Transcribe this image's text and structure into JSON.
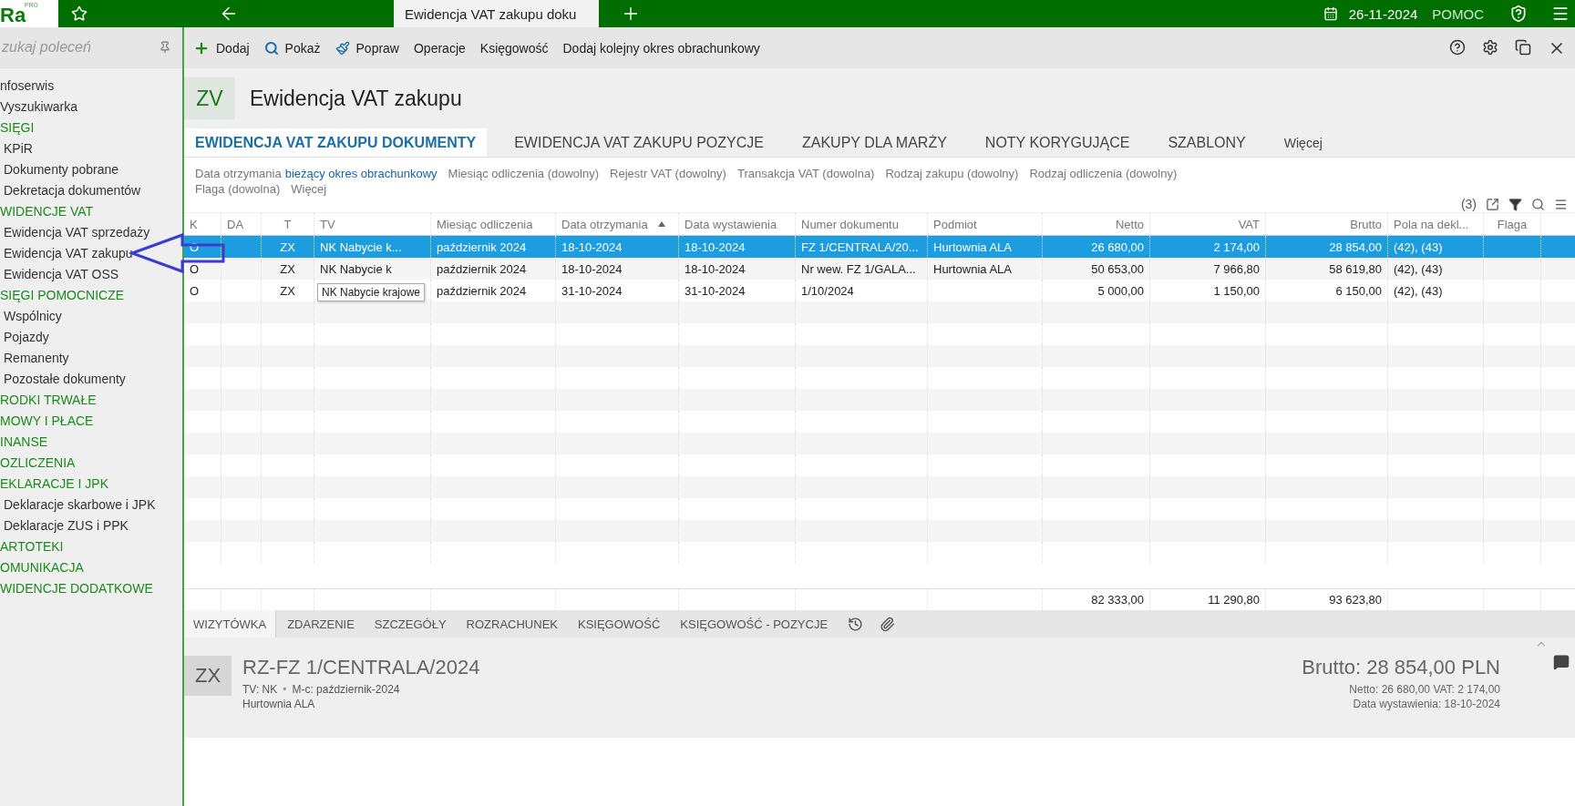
{
  "topbar": {
    "logo": "Ra",
    "logo_sup": "PRO",
    "tab": "Ewidencja VAT zakupu doku",
    "date": "26-11-2024",
    "help": "POMOC"
  },
  "sidebar": {
    "search": {
      "placeholder": "zukaj poleceń"
    },
    "items": [
      {
        "label": "nfoserwis",
        "kind": "link"
      },
      {
        "label": "Vyszukiwarka",
        "kind": "link"
      },
      {
        "label": "SIĘGI",
        "kind": "group",
        "children": [
          {
            "label": "KPiR"
          },
          {
            "label": "Dokumenty pobrane"
          },
          {
            "label": "Dekretacja dokumentów"
          }
        ]
      },
      {
        "label": "WIDENCJE VAT",
        "kind": "group",
        "children": [
          {
            "label": "Ewidencja VAT sprzedaży"
          },
          {
            "label": "Ewidencja VAT zakupu"
          },
          {
            "label": "Ewidencja VAT OSS"
          }
        ]
      },
      {
        "label": "SIĘGI POMOCNICZE",
        "kind": "group",
        "children": [
          {
            "label": "Wspólnicy"
          },
          {
            "label": "Pojazdy"
          },
          {
            "label": "Remanenty"
          },
          {
            "label": "Pozostałe dokumenty"
          }
        ]
      },
      {
        "label": "RODKI TRWAŁE",
        "kind": "group"
      },
      {
        "label": "MOWY I PŁACE",
        "kind": "group"
      },
      {
        "label": "INANSE",
        "kind": "group"
      },
      {
        "label": "OZLICZENIA",
        "kind": "group"
      },
      {
        "label": "EKLARACJE I JPK",
        "kind": "group",
        "children": [
          {
            "label": "Deklaracje skarbowe i JPK"
          },
          {
            "label": "Deklaracje ZUS i PPK"
          }
        ]
      },
      {
        "label": "ARTOTEKI",
        "kind": "group"
      },
      {
        "label": "OMUNIKACJA",
        "kind": "group"
      },
      {
        "label": "WIDENCJE DODATKOWE",
        "kind": "group"
      }
    ]
  },
  "toolbar": [
    {
      "label": "Dodaj",
      "kind": "add"
    },
    {
      "label": "Pokaż",
      "kind": "show"
    },
    {
      "label": "Popraw",
      "kind": "edit"
    },
    {
      "label": "Operacje",
      "kind": "plain"
    },
    {
      "label": "Księgowość",
      "kind": "plain"
    },
    {
      "label": "Dodaj kolejny okres obrachunkowy",
      "kind": "plain"
    }
  ],
  "header": {
    "badge": "ZV",
    "title": "Ewidencja VAT zakupu"
  },
  "tabs": [
    {
      "label": "EWIDENCJA VAT ZAKUPU DOKUMENTY",
      "selected": true
    },
    {
      "label": "EWIDENCJA VAT ZAKUPU POZYCJE",
      "selected": false
    },
    {
      "label": "ZAKUPY DLA MARŻY",
      "selected": false
    },
    {
      "label": "NOTY KORYGUJĄCE",
      "selected": false
    },
    {
      "label": "SZABLONY",
      "selected": false
    }
  ],
  "tabs_more": "Więcej",
  "filters": [
    {
      "label": "Data otrzymania",
      "value": "bieżący okres obrachunkowy"
    },
    {
      "label": "Miesiąc odliczenia (dowolny)"
    },
    {
      "label": "Rejestr VAT (dowolny)"
    },
    {
      "label": "Transakcja VAT (dowolna)"
    },
    {
      "label": "Rodzaj zakupu (dowolny)"
    },
    {
      "label": "Rodzaj odliczenia (dowolny)"
    },
    {
      "label": "Flaga (dowolna)"
    },
    {
      "label": "Więcej"
    }
  ],
  "count": "(3)",
  "table": {
    "columns": [
      {
        "label": "K"
      },
      {
        "label": "DA"
      },
      {
        "label": "T"
      },
      {
        "label": "TV"
      },
      {
        "label": "Miesiąc odliczenia"
      },
      {
        "label": "Data otrzymania",
        "sorted": true
      },
      {
        "label": "Data wystawienia"
      },
      {
        "label": "Numer dokumentu"
      },
      {
        "label": "Podmiot"
      },
      {
        "label": "Netto"
      },
      {
        "label": "VAT"
      },
      {
        "label": "Brutto"
      },
      {
        "label": "Pola na dekl..."
      },
      {
        "label": "Flaga"
      }
    ],
    "rows": [
      {
        "selected": true,
        "k": "O",
        "t": "ZX",
        "tv": "NK Nabycie k...",
        "month": "październik 2024",
        "received": "18-10-2024",
        "issued": "18-10-2024",
        "number": "FZ 1/CENTRALA/20...",
        "party": "Hurtownia ALA",
        "netto": "26 680,00",
        "vat": "2 174,00",
        "brutto": "28 854,00",
        "fields": "(42), (43)"
      },
      {
        "selected": false,
        "k": "O",
        "t": "ZX",
        "tv": "NK Nabycie k",
        "month": "październik 2024",
        "received": "18-10-2024",
        "issued": "18-10-2024",
        "number": "Nr wew. FZ 1/GALA...",
        "party": "Hurtownia ALA",
        "netto": "50 653,00",
        "vat": "7 966,80",
        "brutto": "58 619,80",
        "fields": "(42), (43)"
      },
      {
        "selected": false,
        "k": "O",
        "t": "ZX",
        "month": "październik 2024",
        "received": "31-10-2024",
        "issued": "31-10-2024",
        "number": "1/10/2024",
        "netto": "5 000,00",
        "vat": "1 150,00",
        "brutto": "6 150,00",
        "fields": "(42), (43)"
      }
    ],
    "totals": {
      "netto": "82 333,00",
      "vat": "11 290,80",
      "brutto": "93 623,80"
    },
    "tooltip": "NK Nabycie krajowe"
  },
  "bottom_tabs": [
    {
      "label": "WIZYTÓWKA",
      "selected": true
    },
    {
      "label": "ZDARZENIE",
      "selected": false
    },
    {
      "label": "SZCZEGÓŁY",
      "selected": false
    },
    {
      "label": "ROZRACHUNEK",
      "selected": false
    },
    {
      "label": "KSIĘGOWOŚĆ",
      "selected": false
    },
    {
      "label": "KSIĘGOWOŚĆ - POZYCJE",
      "selected": false
    }
  ],
  "detail": {
    "badge": "ZX",
    "title": "RZ-FZ 1/CENTRALA/2024",
    "tv": "TV: NK",
    "sep": "•",
    "month": "M-c: październik-2024",
    "party": "Hurtownia ALA",
    "brutto": "Brutto: 28 854,00 PLN",
    "netto_vat": "Netto: 26 680,00 VAT: 2 174,00",
    "issued": "Data wystawienia: 18-10-2024"
  }
}
